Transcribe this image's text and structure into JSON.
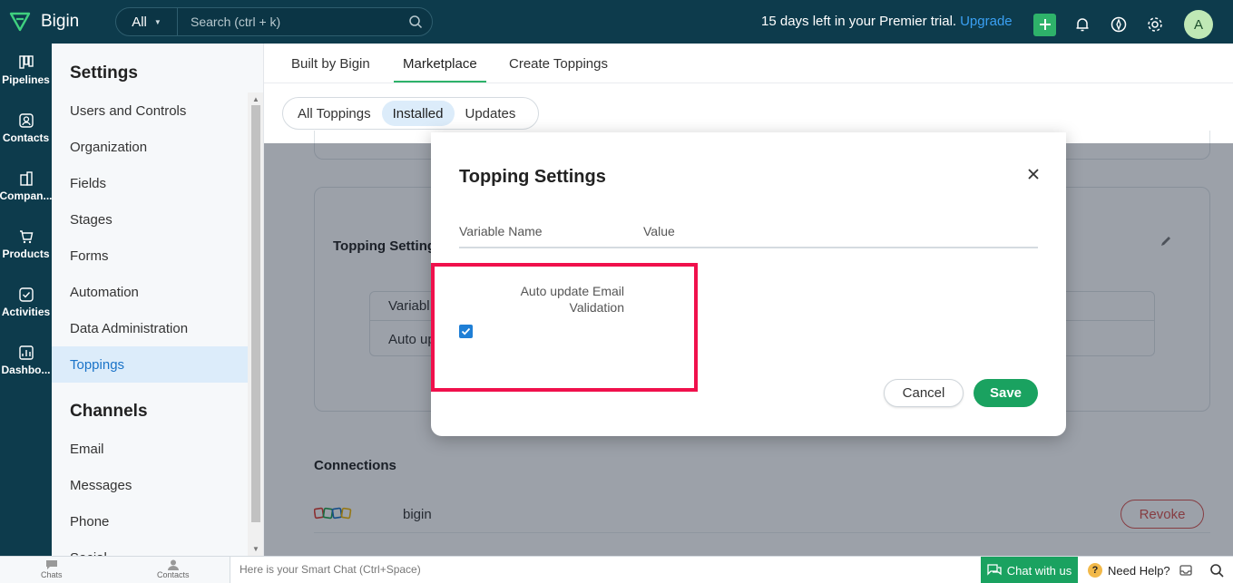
{
  "app": {
    "name": "Bigin"
  },
  "search": {
    "scope": "All",
    "placeholder": "Search (ctrl + k)"
  },
  "trial": {
    "text": "15 days left in your Premier trial.",
    "upgrade_label": "Upgrade"
  },
  "user": {
    "avatar_letter": "A"
  },
  "leftnav": {
    "items": [
      {
        "label": "Pipelines",
        "icon": "pipelines-icon"
      },
      {
        "label": "Contacts",
        "icon": "contacts-icon"
      },
      {
        "label": "Compan...",
        "icon": "companies-icon"
      },
      {
        "label": "Products",
        "icon": "products-icon"
      },
      {
        "label": "Activities",
        "icon": "activities-icon"
      },
      {
        "label": "Dashbo...",
        "icon": "dashboards-icon"
      }
    ]
  },
  "sidebar": {
    "title": "Settings",
    "items": [
      {
        "label": "Users and Controls"
      },
      {
        "label": "Organization"
      },
      {
        "label": "Fields"
      },
      {
        "label": "Stages"
      },
      {
        "label": "Forms"
      },
      {
        "label": "Automation"
      },
      {
        "label": "Data Administration"
      },
      {
        "label": "Toppings",
        "active": true
      }
    ],
    "channels_title": "Channels",
    "channels": [
      {
        "label": "Email"
      },
      {
        "label": "Messages"
      },
      {
        "label": "Phone"
      },
      {
        "label": "Social"
      }
    ]
  },
  "main": {
    "tabs": [
      {
        "label": "Built by Bigin"
      },
      {
        "label": "Marketplace",
        "active": true
      },
      {
        "label": "Create Toppings"
      }
    ],
    "filters": [
      {
        "label": "All Toppings"
      },
      {
        "label": "Installed",
        "active": true
      },
      {
        "label": "Updates"
      }
    ],
    "topping_settings_card": {
      "title": "Topping Setting",
      "col_header": "Variabl",
      "row_value": "Auto up"
    },
    "connections": {
      "title": "Connections",
      "rows": [
        {
          "name": "bigin",
          "action": "Revoke"
        }
      ]
    }
  },
  "modal": {
    "title": "Topping Settings",
    "columns": {
      "name": "Variable Name",
      "value": "Value"
    },
    "variable_label": "Auto update Email Validation",
    "checkbox_checked": true,
    "cancel_label": "Cancel",
    "save_label": "Save"
  },
  "bottombar": {
    "tabs": [
      {
        "label": "Chats"
      },
      {
        "label": "Contacts"
      }
    ],
    "smartchat_placeholder": "Here is your Smart Chat (Ctrl+Space)",
    "chat_label": "Chat with us",
    "help_label": "Need Help?"
  },
  "colors": {
    "nav_bg": "#0d3b4c",
    "accent_green": "#1aa260",
    "link_blue": "#3aa0f3",
    "highlight": "#f0104c"
  }
}
